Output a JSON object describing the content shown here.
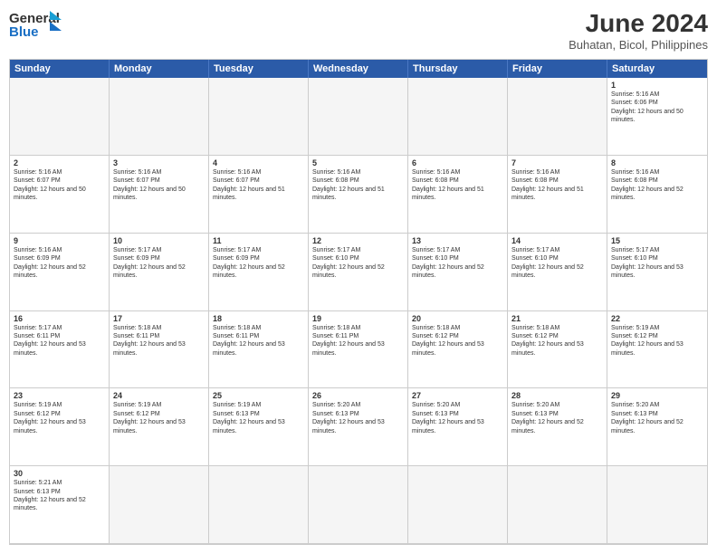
{
  "logo": {
    "text_general": "General",
    "text_blue": "Blue"
  },
  "title": {
    "month_year": "June 2024",
    "location": "Buhatan, Bicol, Philippines"
  },
  "headers": [
    "Sunday",
    "Monday",
    "Tuesday",
    "Wednesday",
    "Thursday",
    "Friday",
    "Saturday"
  ],
  "weeks": [
    [
      {
        "day": "",
        "info": ""
      },
      {
        "day": "",
        "info": ""
      },
      {
        "day": "",
        "info": ""
      },
      {
        "day": "",
        "info": ""
      },
      {
        "day": "",
        "info": ""
      },
      {
        "day": "",
        "info": ""
      },
      {
        "day": "1",
        "info": "Sunrise: 5:16 AM\nSunset: 6:06 PM\nDaylight: 12 hours and 50 minutes."
      }
    ],
    [
      {
        "day": "2",
        "info": "Sunrise: 5:16 AM\nSunset: 6:07 PM\nDaylight: 12 hours and 50 minutes."
      },
      {
        "day": "3",
        "info": "Sunrise: 5:16 AM\nSunset: 6:07 PM\nDaylight: 12 hours and 50 minutes."
      },
      {
        "day": "4",
        "info": "Sunrise: 5:16 AM\nSunset: 6:07 PM\nDaylight: 12 hours and 51 minutes."
      },
      {
        "day": "5",
        "info": "Sunrise: 5:16 AM\nSunset: 6:08 PM\nDaylight: 12 hours and 51 minutes."
      },
      {
        "day": "6",
        "info": "Sunrise: 5:16 AM\nSunset: 6:08 PM\nDaylight: 12 hours and 51 minutes."
      },
      {
        "day": "7",
        "info": "Sunrise: 5:16 AM\nSunset: 6:08 PM\nDaylight: 12 hours and 51 minutes."
      },
      {
        "day": "8",
        "info": "Sunrise: 5:16 AM\nSunset: 6:08 PM\nDaylight: 12 hours and 52 minutes."
      }
    ],
    [
      {
        "day": "9",
        "info": "Sunrise: 5:16 AM\nSunset: 6:09 PM\nDaylight: 12 hours and 52 minutes."
      },
      {
        "day": "10",
        "info": "Sunrise: 5:17 AM\nSunset: 6:09 PM\nDaylight: 12 hours and 52 minutes."
      },
      {
        "day": "11",
        "info": "Sunrise: 5:17 AM\nSunset: 6:09 PM\nDaylight: 12 hours and 52 minutes."
      },
      {
        "day": "12",
        "info": "Sunrise: 5:17 AM\nSunset: 6:10 PM\nDaylight: 12 hours and 52 minutes."
      },
      {
        "day": "13",
        "info": "Sunrise: 5:17 AM\nSunset: 6:10 PM\nDaylight: 12 hours and 52 minutes."
      },
      {
        "day": "14",
        "info": "Sunrise: 5:17 AM\nSunset: 6:10 PM\nDaylight: 12 hours and 52 minutes."
      },
      {
        "day": "15",
        "info": "Sunrise: 5:17 AM\nSunset: 6:10 PM\nDaylight: 12 hours and 53 minutes."
      }
    ],
    [
      {
        "day": "16",
        "info": "Sunrise: 5:17 AM\nSunset: 6:11 PM\nDaylight: 12 hours and 53 minutes."
      },
      {
        "day": "17",
        "info": "Sunrise: 5:18 AM\nSunset: 6:11 PM\nDaylight: 12 hours and 53 minutes."
      },
      {
        "day": "18",
        "info": "Sunrise: 5:18 AM\nSunset: 6:11 PM\nDaylight: 12 hours and 53 minutes."
      },
      {
        "day": "19",
        "info": "Sunrise: 5:18 AM\nSunset: 6:11 PM\nDaylight: 12 hours and 53 minutes."
      },
      {
        "day": "20",
        "info": "Sunrise: 5:18 AM\nSunset: 6:12 PM\nDaylight: 12 hours and 53 minutes."
      },
      {
        "day": "21",
        "info": "Sunrise: 5:18 AM\nSunset: 6:12 PM\nDaylight: 12 hours and 53 minutes."
      },
      {
        "day": "22",
        "info": "Sunrise: 5:19 AM\nSunset: 6:12 PM\nDaylight: 12 hours and 53 minutes."
      }
    ],
    [
      {
        "day": "23",
        "info": "Sunrise: 5:19 AM\nSunset: 6:12 PM\nDaylight: 12 hours and 53 minutes."
      },
      {
        "day": "24",
        "info": "Sunrise: 5:19 AM\nSunset: 6:12 PM\nDaylight: 12 hours and 53 minutes."
      },
      {
        "day": "25",
        "info": "Sunrise: 5:19 AM\nSunset: 6:13 PM\nDaylight: 12 hours and 53 minutes."
      },
      {
        "day": "26",
        "info": "Sunrise: 5:20 AM\nSunset: 6:13 PM\nDaylight: 12 hours and 53 minutes."
      },
      {
        "day": "27",
        "info": "Sunrise: 5:20 AM\nSunset: 6:13 PM\nDaylight: 12 hours and 53 minutes."
      },
      {
        "day": "28",
        "info": "Sunrise: 5:20 AM\nSunset: 6:13 PM\nDaylight: 12 hours and 52 minutes."
      },
      {
        "day": "29",
        "info": "Sunrise: 5:20 AM\nSunset: 6:13 PM\nDaylight: 12 hours and 52 minutes."
      }
    ],
    [
      {
        "day": "30",
        "info": "Sunrise: 5:21 AM\nSunset: 6:13 PM\nDaylight: 12 hours and 52 minutes."
      },
      {
        "day": "",
        "info": ""
      },
      {
        "day": "",
        "info": ""
      },
      {
        "day": "",
        "info": ""
      },
      {
        "day": "",
        "info": ""
      },
      {
        "day": "",
        "info": ""
      },
      {
        "day": "",
        "info": ""
      }
    ]
  ]
}
